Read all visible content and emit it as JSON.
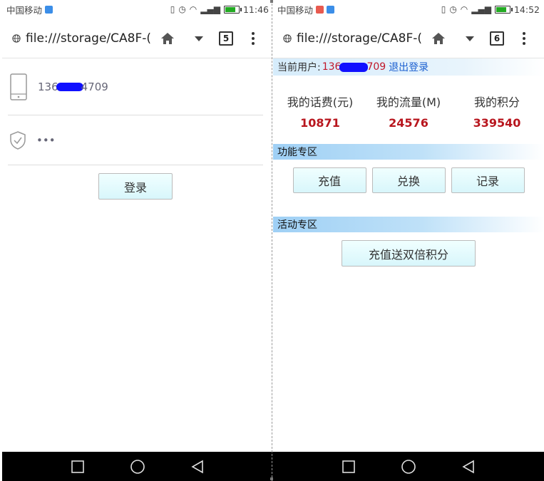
{
  "left": {
    "status": {
      "carrier": "中国移动",
      "time": "11:46"
    },
    "toolbar": {
      "url": "file:///storage/CA8F-(",
      "tab_count": "5"
    },
    "login": {
      "phone_prefix": "136",
      "phone_suffix": "4709",
      "password": "•••",
      "login_label": "登录"
    }
  },
  "right": {
    "status": {
      "carrier": "中国移动",
      "time": "14:52"
    },
    "toolbar": {
      "url": "file:///storage/CA8F-(",
      "tab_count": "6"
    },
    "user_bar": {
      "label": "当前用户:",
      "phone_prefix": "136",
      "phone_suffix": "709",
      "logout_label": "退出登录"
    },
    "stats": [
      {
        "label": "我的话费(元)",
        "value": "10871"
      },
      {
        "label": "我的流量(M)",
        "value": "24576"
      },
      {
        "label": "我的积分",
        "value": "339540"
      }
    ],
    "function_section": {
      "title": "功能专区",
      "buttons": [
        "充值",
        "兑换",
        "记录"
      ]
    },
    "activity_section": {
      "title": "活动专区",
      "promo_label": "充值送双倍积分"
    }
  },
  "colors": {
    "stat_value": "#b8161e",
    "logout_link": "#1a5fd0",
    "phone_number": "#c0182a",
    "section_bar": "#9fd0f5",
    "button_bg": "#d8f6fb",
    "redaction": "#1010ff"
  },
  "icons": [
    "globe-icon",
    "home-icon",
    "dropdown-icon",
    "more-icon",
    "phone-device-icon",
    "shield-check-icon",
    "nav-recent-icon",
    "nav-home-icon",
    "nav-back-icon"
  ]
}
